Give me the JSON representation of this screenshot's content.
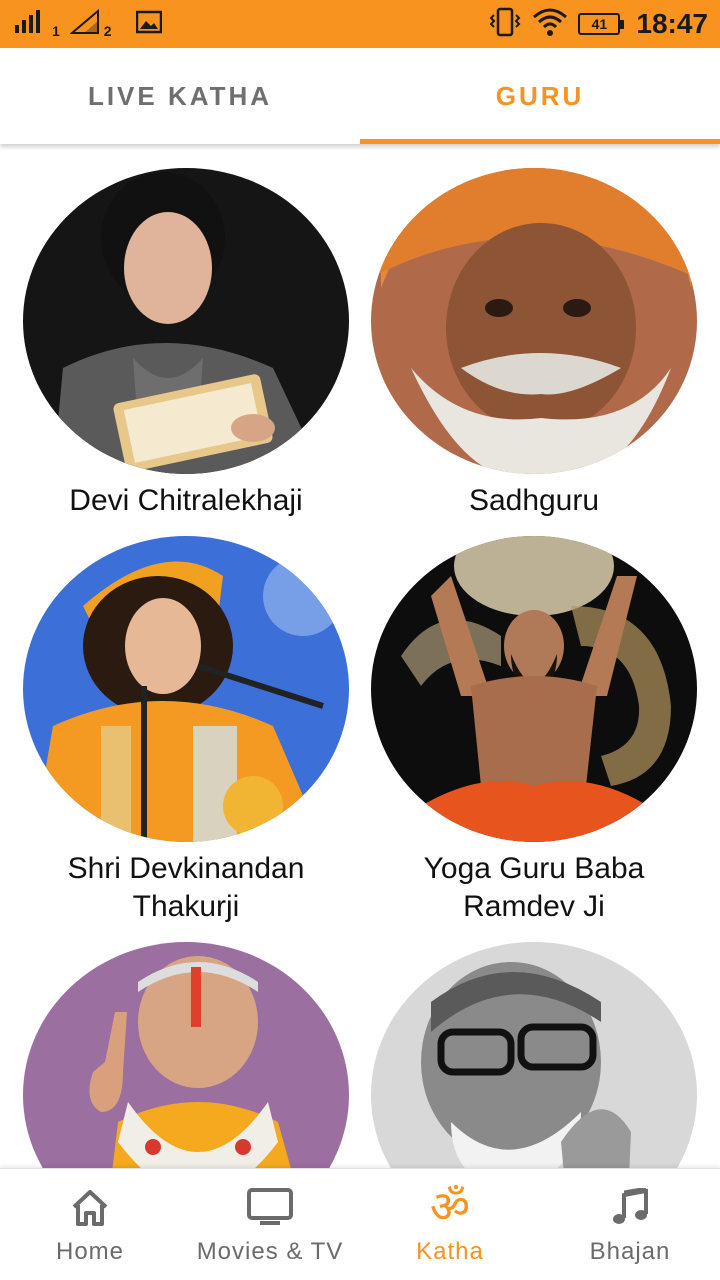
{
  "status_bar": {
    "sim1": "1",
    "sim2": "2",
    "battery": "41",
    "time": "18:47"
  },
  "tabs": [
    {
      "label": "LIVE KATHA",
      "active": false
    },
    {
      "label": "GURU",
      "active": true
    }
  ],
  "gurus": [
    {
      "name": "Devi Chitralekhaji"
    },
    {
      "name": "Sadhguru"
    },
    {
      "name": "Shri Devkinandan Thakurji"
    },
    {
      "name": "Yoga Guru Baba Ramdev Ji"
    },
    {
      "name": ""
    },
    {
      "name": ""
    }
  ],
  "bottom_nav": [
    {
      "label": "Home",
      "icon": "home-icon"
    },
    {
      "label": "Movies & TV",
      "icon": "tv-icon"
    },
    {
      "label": "Katha",
      "icon": "om-icon",
      "active": true
    },
    {
      "label": "Bhajan",
      "icon": "music-note-icon"
    }
  ],
  "colors": {
    "accent": "#f7931e",
    "inactive": "#6b6b6b"
  }
}
